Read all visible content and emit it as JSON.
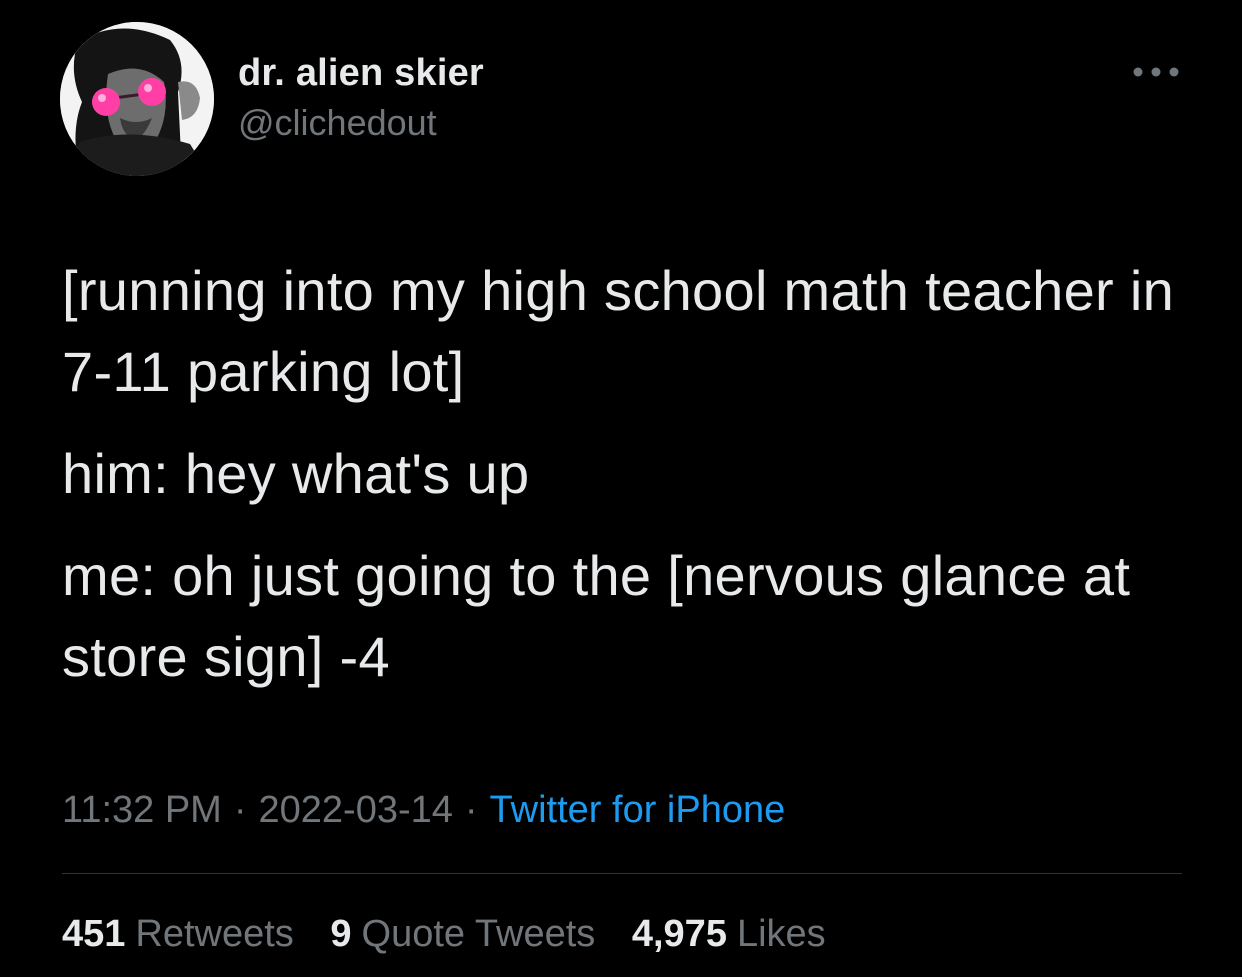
{
  "author": {
    "display_name": "dr. alien skier",
    "handle": "@clichedout"
  },
  "icons": {
    "more": "more-horizontal-icon",
    "avatar": "profile-avatar"
  },
  "tweet": {
    "paragraphs": [
      "[running into my high school math teacher in 7-11 parking lot]",
      "him: hey what's up",
      "me: oh just going to the [nervous glance at store sign] -4"
    ]
  },
  "meta": {
    "time": "11:32 PM",
    "separator": "·",
    "date": "2022-03-14",
    "source": "Twitter for iPhone"
  },
  "stats": {
    "retweets_count": "451",
    "retweets_label": "Retweets",
    "quotes_count": "9",
    "quotes_label": "Quote Tweets",
    "likes_count": "4,975",
    "likes_label": "Likes"
  },
  "colors": {
    "background": "#000000",
    "text_primary": "#e7e9ea",
    "text_secondary": "#71767b",
    "link": "#1d9bf0",
    "divider": "#2f3336",
    "glasses": "#ff3fa6"
  }
}
